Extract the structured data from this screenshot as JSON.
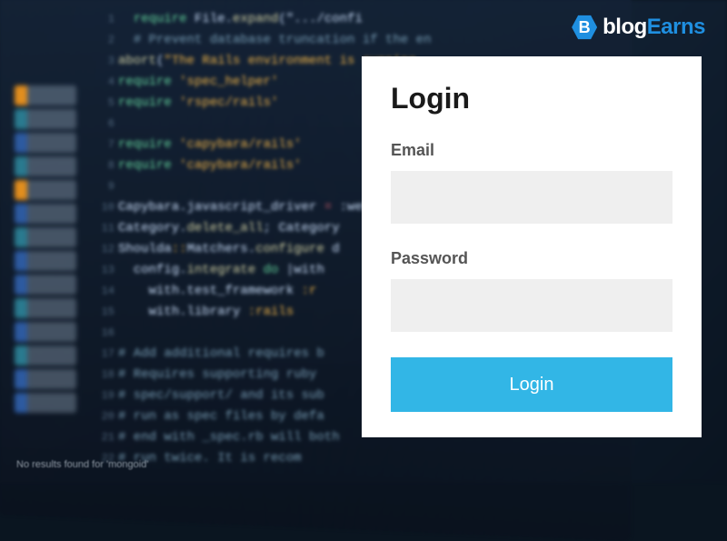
{
  "brand": {
    "icon_letter": "B",
    "text_white": "blog",
    "text_blue": "Earns"
  },
  "login": {
    "title": "Login",
    "email_label": "Email",
    "email_value": "",
    "password_label": "Password",
    "password_value": "",
    "submit_label": "Login"
  },
  "background": {
    "footer_text": "No results found for 'mongoid'",
    "code_lines": [
      {
        "indent": 2,
        "spans": [
          {
            "cls": "c-kw",
            "t": "require"
          },
          {
            "cls": "",
            "t": " File."
          },
          {
            "cls": "c-fn",
            "t": "expand"
          },
          {
            "cls": "",
            "t": "(\""
          },
          {
            "cls": "",
            "t": ".../confi"
          }
        ]
      },
      {
        "indent": 2,
        "spans": [
          {
            "cls": "c-cmt",
            "t": "# Prevent database truncation if the en"
          }
        ]
      },
      {
        "indent": 0,
        "spans": [
          {
            "cls": "c-fn",
            "t": "abort"
          },
          {
            "cls": "",
            "t": "("
          },
          {
            "cls": "c-str",
            "t": "\"The Rails environment is running "
          }
        ]
      },
      {
        "indent": 0,
        "spans": [
          {
            "cls": "c-kw",
            "t": "require"
          },
          {
            "cls": "",
            "t": " "
          },
          {
            "cls": "c-str",
            "t": "'spec_helper'"
          }
        ]
      },
      {
        "indent": 0,
        "spans": [
          {
            "cls": "c-kw",
            "t": "require"
          },
          {
            "cls": "",
            "t": " "
          },
          {
            "cls": "c-str",
            "t": "'rspec/rails'"
          }
        ]
      },
      {
        "indent": 0,
        "spans": [
          {
            "cls": "",
            "t": " "
          }
        ]
      },
      {
        "indent": 0,
        "spans": [
          {
            "cls": "c-kw",
            "t": "require"
          },
          {
            "cls": "",
            "t": " "
          },
          {
            "cls": "c-str",
            "t": "'capybara/rails'"
          }
        ]
      },
      {
        "indent": 0,
        "spans": [
          {
            "cls": "c-kw",
            "t": "require"
          },
          {
            "cls": "",
            "t": " "
          },
          {
            "cls": "c-str",
            "t": "'capybara/rails'"
          }
        ]
      },
      {
        "indent": 0,
        "spans": [
          {
            "cls": "",
            "t": " "
          }
        ]
      },
      {
        "indent": 0,
        "spans": [
          {
            "cls": "",
            "t": "Capybara.javascript_driver "
          },
          {
            "cls": "c-op",
            "t": "="
          },
          {
            "cls": "",
            "t": " :webki"
          }
        ]
      },
      {
        "indent": 0,
        "spans": [
          {
            "cls": "",
            "t": "Category."
          },
          {
            "cls": "c-fn",
            "t": "delete_all"
          },
          {
            "cls": "",
            "t": "; Category"
          }
        ]
      },
      {
        "indent": 0,
        "spans": [
          {
            "cls": "",
            "t": "Shoulda"
          },
          {
            "cls": "c-str",
            "t": "::"
          },
          {
            "cls": "",
            "t": "Matchers."
          },
          {
            "cls": "c-fn",
            "t": "configure"
          },
          {
            "cls": "",
            "t": " d"
          }
        ]
      },
      {
        "indent": 2,
        "spans": [
          {
            "cls": "",
            "t": "config."
          },
          {
            "cls": "c-fn",
            "t": "integrate"
          },
          {
            "cls": "",
            "t": " "
          },
          {
            "cls": "c-kw",
            "t": "do"
          },
          {
            "cls": "",
            "t": " |with"
          }
        ]
      },
      {
        "indent": 4,
        "spans": [
          {
            "cls": "",
            "t": "with.test_framework "
          },
          {
            "cls": "c-str",
            "t": ":r"
          }
        ]
      },
      {
        "indent": 4,
        "spans": [
          {
            "cls": "",
            "t": "with.library "
          },
          {
            "cls": "c-str",
            "t": ":rails"
          }
        ]
      },
      {
        "indent": 0,
        "spans": [
          {
            "cls": "",
            "t": " "
          }
        ]
      },
      {
        "indent": 0,
        "spans": [
          {
            "cls": "c-cmt",
            "t": "# Add additional requires b"
          }
        ]
      },
      {
        "indent": 0,
        "spans": [
          {
            "cls": "c-cmt",
            "t": "# Requires supporting ruby"
          }
        ]
      },
      {
        "indent": 0,
        "spans": [
          {
            "cls": "c-cmt",
            "t": "# spec/support/ and its sub"
          }
        ]
      },
      {
        "indent": 0,
        "spans": [
          {
            "cls": "c-cmt",
            "t": "# run as spec files by defa"
          }
        ]
      },
      {
        "indent": 0,
        "spans": [
          {
            "cls": "c-cmt",
            "t": "# end with _spec.rb will both "
          }
        ]
      },
      {
        "indent": 0,
        "spans": [
          {
            "cls": "c-cmt",
            "t": "# run twice. It is recom"
          }
        ]
      }
    ],
    "gutter_start": 1
  }
}
